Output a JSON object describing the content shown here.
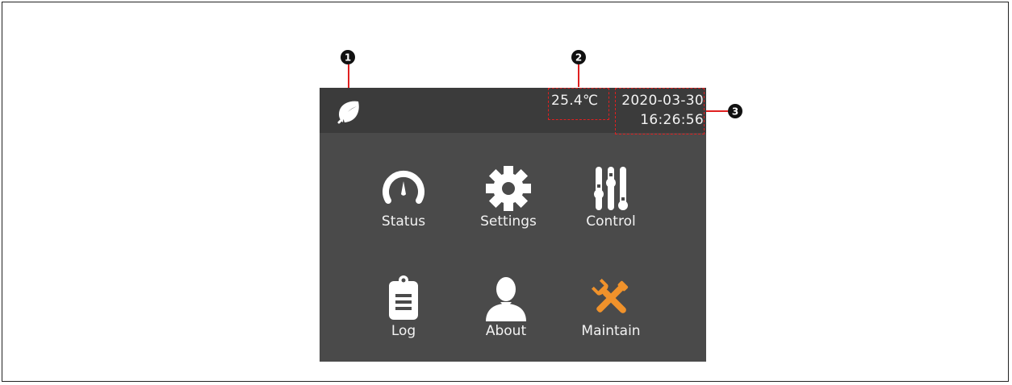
{
  "header": {
    "temperature": "25.4℃",
    "date": "2020-03-30",
    "time": "16:26:56"
  },
  "callouts": [
    "1",
    "2",
    "3"
  ],
  "menu": {
    "items": [
      {
        "label": "Status",
        "icon": "gauge-icon"
      },
      {
        "label": "Settings",
        "icon": "gear-icon"
      },
      {
        "label": "Control",
        "icon": "sliders-icon"
      },
      {
        "label": "Log",
        "icon": "clipboard-icon"
      },
      {
        "label": "About",
        "icon": "user-icon"
      },
      {
        "label": "Maintain",
        "icon": "wrench-screwdriver-icon"
      }
    ]
  },
  "colors": {
    "screen_bg": "#4a4a4a",
    "topbar_bg": "#3b3b3b",
    "text": "#f2f2f2",
    "accent_orange": "#f0922b",
    "highlight_red": "#e02020"
  }
}
